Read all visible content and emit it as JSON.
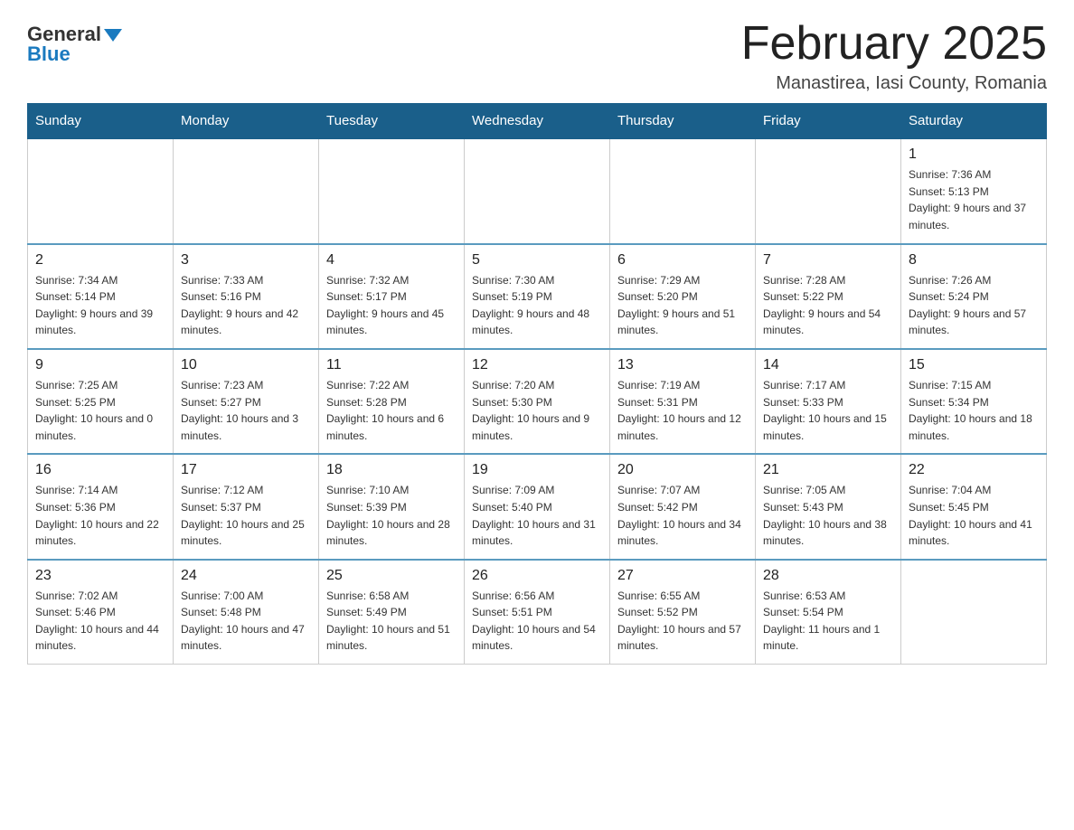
{
  "header": {
    "logo_general": "General",
    "logo_blue": "Blue",
    "month_title": "February 2025",
    "location": "Manastirea, Iasi County, Romania"
  },
  "days_of_week": [
    "Sunday",
    "Monday",
    "Tuesday",
    "Wednesday",
    "Thursday",
    "Friday",
    "Saturday"
  ],
  "weeks": [
    [
      {
        "day": "",
        "info": ""
      },
      {
        "day": "",
        "info": ""
      },
      {
        "day": "",
        "info": ""
      },
      {
        "day": "",
        "info": ""
      },
      {
        "day": "",
        "info": ""
      },
      {
        "day": "",
        "info": ""
      },
      {
        "day": "1",
        "info": "Sunrise: 7:36 AM\nSunset: 5:13 PM\nDaylight: 9 hours and 37 minutes."
      }
    ],
    [
      {
        "day": "2",
        "info": "Sunrise: 7:34 AM\nSunset: 5:14 PM\nDaylight: 9 hours and 39 minutes."
      },
      {
        "day": "3",
        "info": "Sunrise: 7:33 AM\nSunset: 5:16 PM\nDaylight: 9 hours and 42 minutes."
      },
      {
        "day": "4",
        "info": "Sunrise: 7:32 AM\nSunset: 5:17 PM\nDaylight: 9 hours and 45 minutes."
      },
      {
        "day": "5",
        "info": "Sunrise: 7:30 AM\nSunset: 5:19 PM\nDaylight: 9 hours and 48 minutes."
      },
      {
        "day": "6",
        "info": "Sunrise: 7:29 AM\nSunset: 5:20 PM\nDaylight: 9 hours and 51 minutes."
      },
      {
        "day": "7",
        "info": "Sunrise: 7:28 AM\nSunset: 5:22 PM\nDaylight: 9 hours and 54 minutes."
      },
      {
        "day": "8",
        "info": "Sunrise: 7:26 AM\nSunset: 5:24 PM\nDaylight: 9 hours and 57 minutes."
      }
    ],
    [
      {
        "day": "9",
        "info": "Sunrise: 7:25 AM\nSunset: 5:25 PM\nDaylight: 10 hours and 0 minutes."
      },
      {
        "day": "10",
        "info": "Sunrise: 7:23 AM\nSunset: 5:27 PM\nDaylight: 10 hours and 3 minutes."
      },
      {
        "day": "11",
        "info": "Sunrise: 7:22 AM\nSunset: 5:28 PM\nDaylight: 10 hours and 6 minutes."
      },
      {
        "day": "12",
        "info": "Sunrise: 7:20 AM\nSunset: 5:30 PM\nDaylight: 10 hours and 9 minutes."
      },
      {
        "day": "13",
        "info": "Sunrise: 7:19 AM\nSunset: 5:31 PM\nDaylight: 10 hours and 12 minutes."
      },
      {
        "day": "14",
        "info": "Sunrise: 7:17 AM\nSunset: 5:33 PM\nDaylight: 10 hours and 15 minutes."
      },
      {
        "day": "15",
        "info": "Sunrise: 7:15 AM\nSunset: 5:34 PM\nDaylight: 10 hours and 18 minutes."
      }
    ],
    [
      {
        "day": "16",
        "info": "Sunrise: 7:14 AM\nSunset: 5:36 PM\nDaylight: 10 hours and 22 minutes."
      },
      {
        "day": "17",
        "info": "Sunrise: 7:12 AM\nSunset: 5:37 PM\nDaylight: 10 hours and 25 minutes."
      },
      {
        "day": "18",
        "info": "Sunrise: 7:10 AM\nSunset: 5:39 PM\nDaylight: 10 hours and 28 minutes."
      },
      {
        "day": "19",
        "info": "Sunrise: 7:09 AM\nSunset: 5:40 PM\nDaylight: 10 hours and 31 minutes."
      },
      {
        "day": "20",
        "info": "Sunrise: 7:07 AM\nSunset: 5:42 PM\nDaylight: 10 hours and 34 minutes."
      },
      {
        "day": "21",
        "info": "Sunrise: 7:05 AM\nSunset: 5:43 PM\nDaylight: 10 hours and 38 minutes."
      },
      {
        "day": "22",
        "info": "Sunrise: 7:04 AM\nSunset: 5:45 PM\nDaylight: 10 hours and 41 minutes."
      }
    ],
    [
      {
        "day": "23",
        "info": "Sunrise: 7:02 AM\nSunset: 5:46 PM\nDaylight: 10 hours and 44 minutes."
      },
      {
        "day": "24",
        "info": "Sunrise: 7:00 AM\nSunset: 5:48 PM\nDaylight: 10 hours and 47 minutes."
      },
      {
        "day": "25",
        "info": "Sunrise: 6:58 AM\nSunset: 5:49 PM\nDaylight: 10 hours and 51 minutes."
      },
      {
        "day": "26",
        "info": "Sunrise: 6:56 AM\nSunset: 5:51 PM\nDaylight: 10 hours and 54 minutes."
      },
      {
        "day": "27",
        "info": "Sunrise: 6:55 AM\nSunset: 5:52 PM\nDaylight: 10 hours and 57 minutes."
      },
      {
        "day": "28",
        "info": "Sunrise: 6:53 AM\nSunset: 5:54 PM\nDaylight: 11 hours and 1 minute."
      },
      {
        "day": "",
        "info": ""
      }
    ]
  ]
}
